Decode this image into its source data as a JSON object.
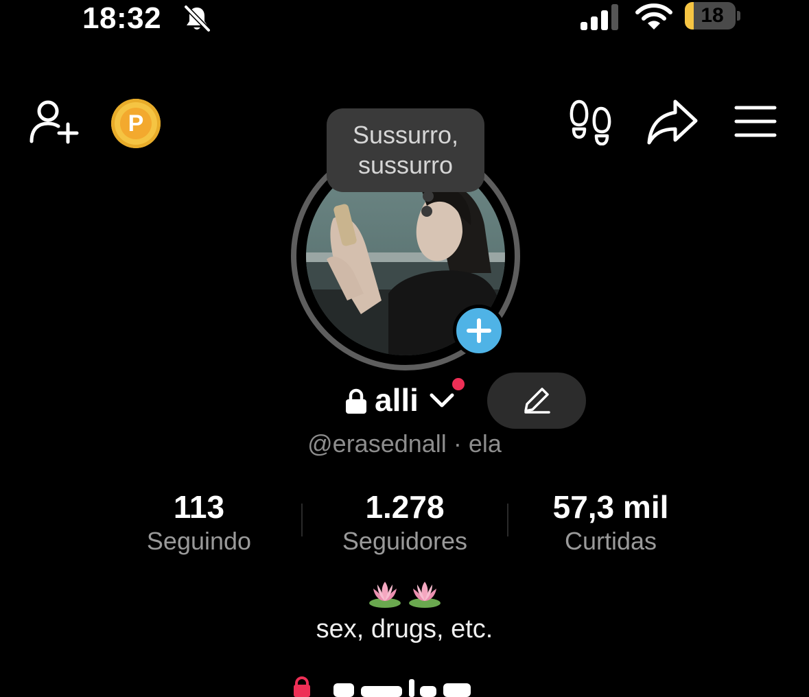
{
  "status_bar": {
    "time": "18:32",
    "battery_level": "18",
    "icons": [
      "bell-muted-icon",
      "cellular-signal-icon",
      "wifi-icon",
      "battery-icon"
    ]
  },
  "nav": {
    "icons": [
      "add-friend-icon",
      "coin-icon",
      "footprints-icon",
      "share-icon",
      "menu-icon"
    ],
    "coin_letter": "P"
  },
  "avatar": {
    "bubble_line1": "Sussurro,",
    "bubble_line2": "sussurro"
  },
  "profile": {
    "name": "alli",
    "handle": "@erasednall",
    "pronoun_separator": "·",
    "pronouns": "ela"
  },
  "stats": [
    {
      "value": "113",
      "label": "Seguindo"
    },
    {
      "value": "1.278",
      "label": "Seguidores"
    },
    {
      "value": "57,3 mil",
      "label": "Curtidas"
    }
  ],
  "bio": {
    "emojis": "🪷🪷",
    "text": "sex, drugs, etc."
  },
  "colors": {
    "background": "#000000",
    "accent_blue": "#4fb3e6",
    "notification_red": "#ee2f56",
    "coin_gold": "#f5c443",
    "battery_yellow": "#f6c543"
  }
}
